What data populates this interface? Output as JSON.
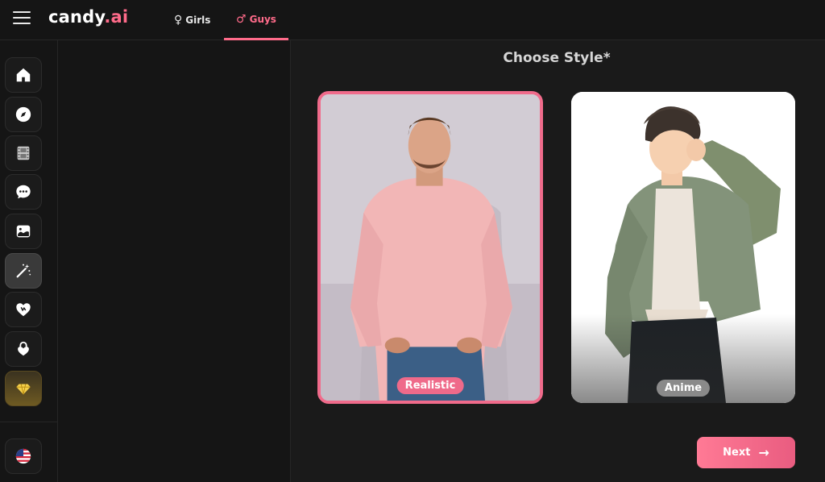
{
  "app": {
    "logo_main": "candy",
    "logo_dot": ".ai"
  },
  "nav": {
    "girls_symbol": "♀",
    "girls_label": "Girls",
    "guys_symbol": "♂",
    "guys_label": "Guys",
    "active_tab": "Guys"
  },
  "sidebar": {
    "items": [
      {
        "icon": "home-icon"
      },
      {
        "icon": "compass-icon"
      },
      {
        "icon": "film-icon"
      },
      {
        "icon": "chat-icon"
      },
      {
        "icon": "gallery-icon"
      },
      {
        "icon": "magic-wand-icon",
        "active": true
      },
      {
        "icon": "heart-icon"
      },
      {
        "icon": "lock-heart-icon"
      },
      {
        "icon": "diamond-icon",
        "premium": true
      },
      {
        "icon": "us-flag-icon"
      }
    ]
  },
  "main": {
    "title": "Choose Style*",
    "styles": [
      {
        "label": "Realistic",
        "selected": true
      },
      {
        "label": "Anime",
        "selected": false
      }
    ],
    "next_label": "Next",
    "next_arrow": "→"
  },
  "colors": {
    "accent": "#ff6b8a",
    "background": "#151515"
  }
}
